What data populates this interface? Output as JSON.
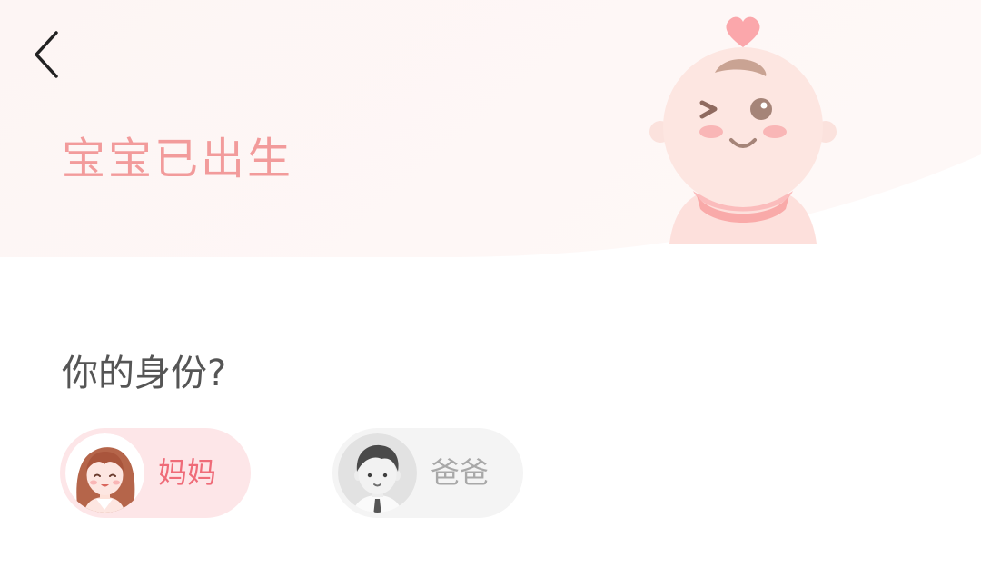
{
  "header": {
    "back_icon": "chevron-left-icon",
    "title": "宝宝已出生",
    "illustration": "baby-illustration"
  },
  "identity": {
    "question": "你的身份?",
    "options": [
      {
        "label": "妈妈",
        "avatar": "mom-avatar",
        "selected": true
      },
      {
        "label": "爸爸",
        "avatar": "dad-avatar",
        "selected": false
      }
    ]
  },
  "colors": {
    "accent": "#f29b9b",
    "selected_bg": "#fde6e8",
    "selected_text": "#ef6b78",
    "unselected_bg": "#f4f4f4",
    "unselected_text": "#a8a8a8"
  }
}
